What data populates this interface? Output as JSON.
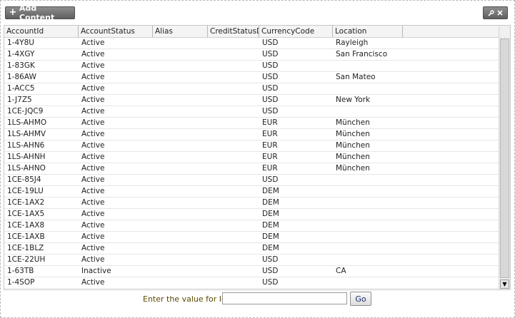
{
  "toolbar": {
    "add_content_label": "Add Content",
    "tools_icons": [
      "wrench-icon",
      "close-icon"
    ]
  },
  "grid": {
    "columns": [
      "AccountId",
      "AccountStatus",
      "Alias",
      "CreditStatusD",
      "CurrencyCode",
      "Location"
    ],
    "rows": [
      [
        "1-4Y8U",
        "Active",
        "",
        "",
        "USD",
        "Rayleigh"
      ],
      [
        "1-4XGY",
        "Active",
        "",
        "",
        "USD",
        "San Francisco"
      ],
      [
        "1-83GK",
        "Active",
        "",
        "",
        "USD",
        ""
      ],
      [
        "1-86AW",
        "Active",
        "",
        "",
        "USD",
        "San Mateo"
      ],
      [
        "1-ACC5",
        "Active",
        "",
        "",
        "USD",
        ""
      ],
      [
        "1-J7Z5",
        "Active",
        "",
        "",
        "USD",
        "New York"
      ],
      [
        "1CE-JQC9",
        "Active",
        "",
        "",
        "USD",
        ""
      ],
      [
        "1LS-AHMO",
        "Active",
        "",
        "",
        "EUR",
        "München"
      ],
      [
        "1LS-AHMV",
        "Active",
        "",
        "",
        "EUR",
        "München"
      ],
      [
        "1LS-AHN6",
        "Active",
        "",
        "",
        "EUR",
        "München"
      ],
      [
        "1LS-AHNH",
        "Active",
        "",
        "",
        "EUR",
        "München"
      ],
      [
        "1LS-AHNO",
        "Active",
        "",
        "",
        "EUR",
        "München"
      ],
      [
        "1CE-85J4",
        "Active",
        "",
        "",
        "USD",
        ""
      ],
      [
        "1CE-19LU",
        "Active",
        "",
        "",
        "DEM",
        ""
      ],
      [
        "1CE-1AX2",
        "Active",
        "",
        "",
        "DEM",
        ""
      ],
      [
        "1CE-1AX5",
        "Active",
        "",
        "",
        "DEM",
        ""
      ],
      [
        "1CE-1AX8",
        "Active",
        "",
        "",
        "DEM",
        ""
      ],
      [
        "1CE-1AXB",
        "Active",
        "",
        "",
        "DEM",
        ""
      ],
      [
        "1CE-1BLZ",
        "Active",
        "",
        "",
        "DEM",
        ""
      ],
      [
        "1CE-22UH",
        "Active",
        "",
        "",
        "USD",
        ""
      ],
      [
        "1-63TB",
        "Inactive",
        "",
        "",
        "USD",
        "CA"
      ],
      [
        "1-4SOP",
        "Active",
        "",
        "",
        "USD",
        ""
      ]
    ]
  },
  "search": {
    "prompt_label": "Enter the value for Id",
    "value": "",
    "go_label": "Go"
  },
  "colors": {
    "button_dark": "#6f6f6f",
    "prompt_text": "#5a4a00",
    "go_text": "#1b2c6e"
  }
}
